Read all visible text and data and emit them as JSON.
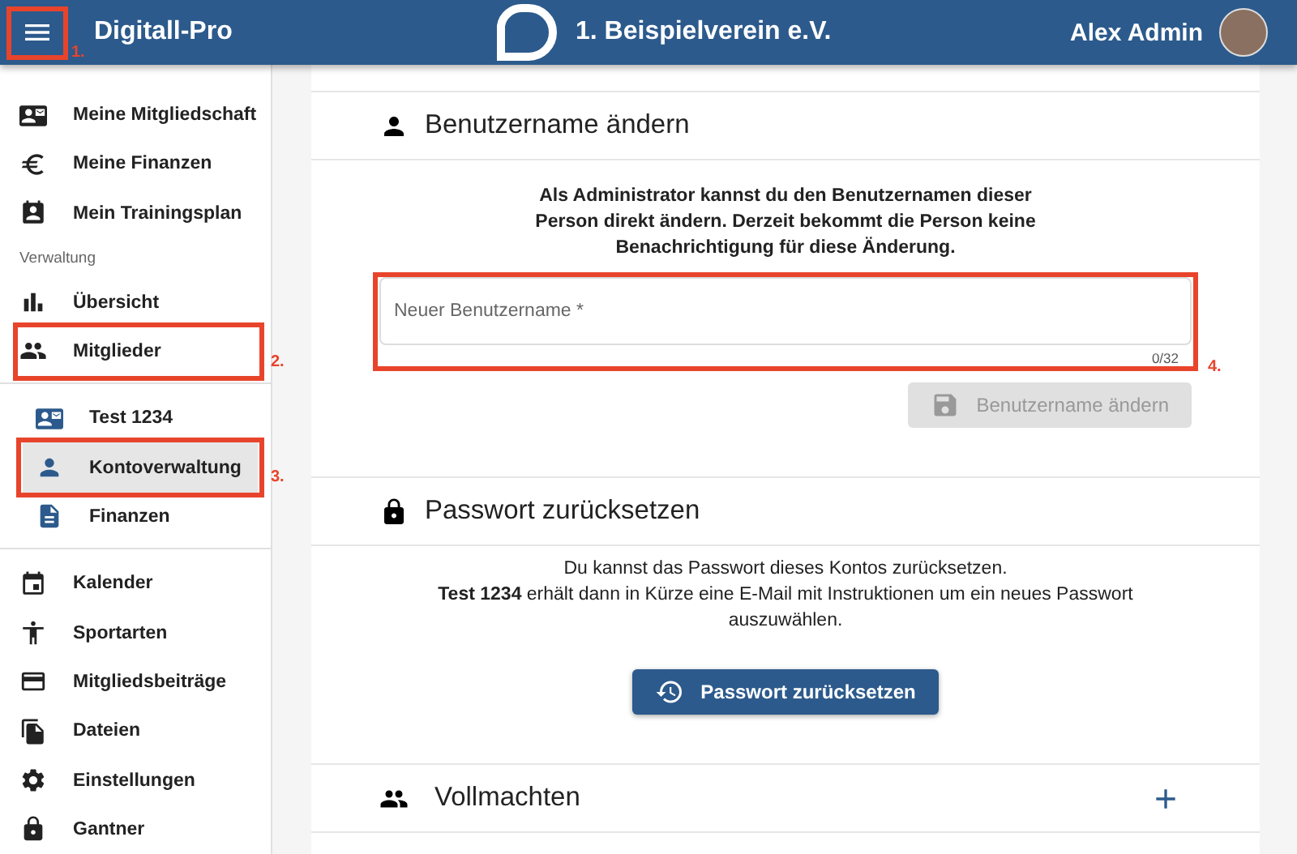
{
  "header": {
    "menu_annotation": "1.",
    "app_name": "Digitall-Pro",
    "club_name": "1. Beispielverein e.V.",
    "user_name": "Alex Admin"
  },
  "sidebar": {
    "items": [
      {
        "kind": "item",
        "label": "Meine Mitgliedschaft",
        "selected": false
      },
      {
        "kind": "item",
        "label": "Meine Finanzen",
        "selected": false
      },
      {
        "kind": "item",
        "label": "Mein Trainingsplan",
        "selected": false
      },
      {
        "kind": "heading",
        "label": "Verwaltung"
      },
      {
        "kind": "item",
        "label": "Übersicht",
        "selected": false
      },
      {
        "kind": "item",
        "label": "Mitglieder",
        "selected": false,
        "annotation": "2."
      },
      {
        "kind": "subitem",
        "label": "Test 1234",
        "selected": false
      },
      {
        "kind": "subitem",
        "label": "Kontoverwaltung",
        "selected": true,
        "annotation": "3."
      },
      {
        "kind": "subitem",
        "label": "Finanzen",
        "selected": false
      },
      {
        "kind": "item",
        "label": "Kalender",
        "selected": false
      },
      {
        "kind": "item",
        "label": "Sportarten",
        "selected": false
      },
      {
        "kind": "item",
        "label": "Mitgliedsbeiträge",
        "selected": false
      },
      {
        "kind": "item",
        "label": "Dateien",
        "selected": false
      },
      {
        "kind": "item",
        "label": "Einstellungen",
        "selected": false
      },
      {
        "kind": "item",
        "label": "Gantner",
        "selected": false
      }
    ]
  },
  "sections": [
    {
      "kind": "username",
      "title": "Benutzername ändern",
      "paragraphs": [
        "Als Administrator kannst du den Benutzernamen dieser Person direkt ändern. Derzeit bekommt die Person keine Benachrichtigung für diese Änderung."
      ],
      "field": {
        "placeholder": "Neuer Benutzername *",
        "counter": "0/32",
        "annotation": "4."
      },
      "button": {
        "label": "Benutzername ändern",
        "disabled": true
      }
    },
    {
      "kind": "password",
      "title": "Passwort zurücksetzen",
      "paragraphs": [
        "Du kannst das Passwort dieses Kontos zurücksetzen.",
        "**Test 1234** erhält dann in Kürze eine E-Mail mit Instruktionen um ein neues Passwort auszuwählen."
      ],
      "button": {
        "label": "Passwort zurücksetzen",
        "disabled": false
      }
    },
    {
      "kind": "authorizations",
      "title": "Vollmachten"
    }
  ]
}
